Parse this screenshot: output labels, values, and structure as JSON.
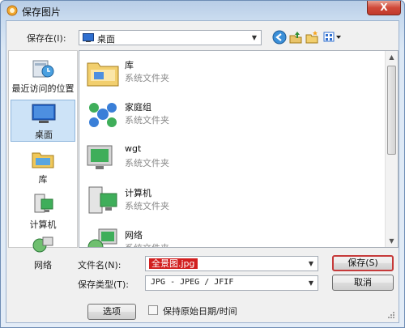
{
  "window": {
    "title": "保存图片",
    "close_label": "X"
  },
  "toolbar": {
    "look_in_label": "保存在(I):",
    "look_in_value": "桌面",
    "icons": [
      "back-arrow-icon",
      "up-folder-icon",
      "new-folder-icon",
      "view-menu-icon"
    ]
  },
  "places": [
    {
      "label": "最近访问的位置",
      "icon": "recent-places-icon"
    },
    {
      "label": "桌面",
      "icon": "desktop-icon",
      "selected": true
    },
    {
      "label": "库",
      "icon": "libraries-icon"
    },
    {
      "label": "计算机",
      "icon": "computer-icon"
    },
    {
      "label": "网络",
      "icon": "network-icon"
    }
  ],
  "files": [
    {
      "name": "库",
      "type": "系统文件夹",
      "icon": "libraries-folder-icon"
    },
    {
      "name": "家庭组",
      "type": "系统文件夹",
      "icon": "homegroup-icon"
    },
    {
      "name": "wgt",
      "type": "系统文件夹",
      "icon": "user-folder-icon"
    },
    {
      "name": "计算机",
      "type": "系统文件夹",
      "icon": "computer-icon"
    },
    {
      "name": "网络",
      "type": "系统文件夹",
      "icon": "network-icon"
    }
  ],
  "form": {
    "filename_label": "文件名(N):",
    "filename_value": "全景图.jpg",
    "filetype_label": "保存类型(T):",
    "filetype_value": "JPG - JPEG / JFIF",
    "save_label": "保存(S)",
    "cancel_label": "取消",
    "options_label": "选项",
    "keep_date_label": "保持原始日期/时间"
  },
  "colors": {
    "selection_red": "#d21f1f",
    "close_red": "#c9402f"
  }
}
